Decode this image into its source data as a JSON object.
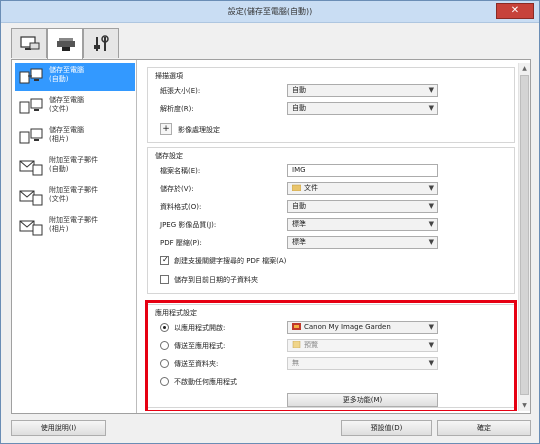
{
  "window": {
    "title": "設定(儲存至電腦(自動))",
    "close_glyph": "✕"
  },
  "tabs": [
    {
      "icon": "monitor-scan-icon"
    },
    {
      "icon": "scanner-icon"
    },
    {
      "icon": "tools-icon"
    }
  ],
  "sidebar": {
    "items": [
      {
        "label_line1": "儲存至電腦",
        "label_line2": "(自動)",
        "icon": "save-to-computer-icon"
      },
      {
        "label_line1": "儲存至電腦",
        "label_line2": "(文件)",
        "icon": "save-to-computer-icon"
      },
      {
        "label_line1": "儲存至電腦",
        "label_line2": "(相片)",
        "icon": "save-to-computer-icon"
      },
      {
        "label_line1": "附加至電子郵件",
        "label_line2": "(自動)",
        "icon": "attach-email-icon"
      },
      {
        "label_line1": "附加至電子郵件",
        "label_line2": "(文件)",
        "icon": "attach-email-icon"
      },
      {
        "label_line1": "附加至電子郵件",
        "label_line2": "(相片)",
        "icon": "attach-email-icon"
      }
    ]
  },
  "scan_options": {
    "title": "掃描選項",
    "paper_size_label": "紙張大小(E):",
    "paper_size_value": "自動",
    "resolution_label": "解析度(R):",
    "resolution_value": "自動",
    "image_processing_label": "影像處理設定",
    "plus_glyph": "+"
  },
  "save_settings": {
    "title": "儲存設定",
    "file_name_label": "檔案名稱(E):",
    "file_name_value": "IMG",
    "save_in_label": "儲存於(V):",
    "save_in_value": "文件",
    "data_format_label": "資料格式(O):",
    "data_format_value": "自動",
    "jpeg_quality_label": "JPEG 影像品質(J):",
    "jpeg_quality_value": "標準",
    "pdf_compression_label": "PDF 壓縮(P):",
    "pdf_compression_value": "標準",
    "keyword_pdf_label": "創建支援關鍵字搜尋的 PDF 檔案(A)",
    "keyword_pdf_checked": true,
    "date_subfolder_label": "儲存到目前日期的子資料夾",
    "date_subfolder_checked": false
  },
  "app_settings": {
    "title": "應用程式設定",
    "open_with_label": "以應用程式開啟:",
    "open_with_value": "Canon My Image Garden",
    "send_to_app_label": "傳送至應用程式:",
    "send_to_app_value": "預覽",
    "send_to_folder_label": "傳送至資料夾:",
    "send_to_folder_value": "無",
    "no_app_label": "不啟動任何應用程式",
    "more_functions_label": "更多功能(M)",
    "selected": "open_with"
  },
  "footer": {
    "help_label": "使用說明(I)",
    "defaults_label": "預設值(D)",
    "ok_label": "確定"
  },
  "arrow_glyph": "▼",
  "check_glyph": "✓",
  "colors": {
    "accent": "#3399ff",
    "highlight_border": "#e60012",
    "titlebar": "#c9ddf3",
    "close": "#c7423a"
  }
}
